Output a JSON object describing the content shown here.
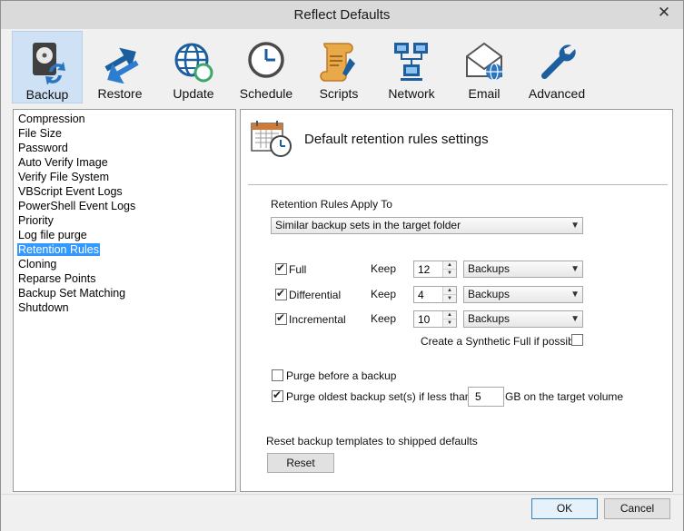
{
  "window": {
    "title": "Reflect Defaults"
  },
  "toolbar": {
    "buttons": [
      {
        "label": "Backup",
        "icon": "backup-icon"
      },
      {
        "label": "Restore",
        "icon": "restore-icon"
      },
      {
        "label": "Update",
        "icon": "update-icon"
      },
      {
        "label": "Schedule",
        "icon": "schedule-icon"
      },
      {
        "label": "Scripts",
        "icon": "scripts-icon"
      },
      {
        "label": "Network",
        "icon": "network-icon"
      },
      {
        "label": "Email",
        "icon": "email-icon"
      },
      {
        "label": "Advanced",
        "icon": "advanced-icon"
      }
    ],
    "active": "Backup"
  },
  "nav": {
    "items": [
      "Compression",
      "File Size",
      "Password",
      "Auto Verify Image",
      "Verify File System",
      "VBScript Event Logs",
      "PowerShell Event Logs",
      "Priority",
      "Log file purge",
      "Retention Rules",
      "Cloning",
      "Reparse Points",
      "Backup Set Matching",
      "Shutdown"
    ],
    "selected": "Retention Rules"
  },
  "panel": {
    "title": "Default retention rules settings",
    "apply_label": "Retention Rules Apply To",
    "apply_value": "Similar backup sets in the target folder",
    "rules": [
      {
        "label": "Full",
        "keep_label": "Keep",
        "value": "12",
        "unit": "Backups",
        "checked": true
      },
      {
        "label": "Differential",
        "keep_label": "Keep",
        "value": "4",
        "unit": "Backups",
        "checked": true
      },
      {
        "label": "Incremental",
        "keep_label": "Keep",
        "value": "10",
        "unit": "Backups",
        "checked": true
      }
    ],
    "synthetic_label": "Create a Synthetic Full if possible",
    "synthetic_checked": false,
    "purge_before_label": "Purge before a backup",
    "purge_before_checked": false,
    "purge_oldest_label": "Purge oldest backup set(s) if less than",
    "purge_oldest_checked": true,
    "purge_value": "5",
    "purge_suffix": "GB on the target volume",
    "reset_label": "Reset backup templates to shipped defaults",
    "reset_button": "Reset"
  },
  "footer": {
    "ok": "OK",
    "cancel": "Cancel"
  },
  "colors": {
    "selection": "#3399ff",
    "active_tab": "#cfe1f5",
    "icon_blue": "#1d5f9e"
  }
}
